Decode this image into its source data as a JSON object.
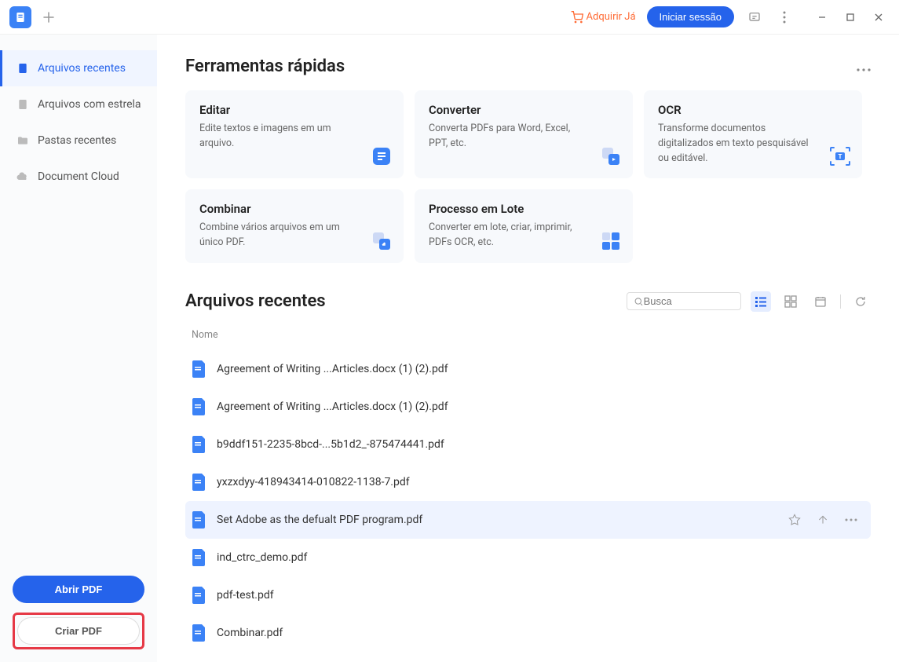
{
  "titlebar": {
    "acquire_label": "Adquirir Já",
    "login_label": "Iniciar sessão"
  },
  "sidebar": {
    "items": [
      {
        "label": "Arquivos recentes"
      },
      {
        "label": "Arquivos com estrela"
      },
      {
        "label": "Pastas recentes"
      },
      {
        "label": "Document Cloud"
      }
    ],
    "open_pdf_label": "Abrir PDF",
    "create_pdf_label": "Criar PDF"
  },
  "quick_tools": {
    "title": "Ferramentas rápidas",
    "cards": [
      {
        "title": "Editar",
        "desc": "Edite textos e imagens em um arquivo."
      },
      {
        "title": "Converter",
        "desc": "Converta PDFs para Word, Excel, PPT, etc."
      },
      {
        "title": "OCR",
        "desc": "Transforme documentos digitalizados em texto pesquisável ou editável."
      },
      {
        "title": "Combinar",
        "desc": "Combine vários arquivos em um único PDF."
      },
      {
        "title": "Processo em Lote",
        "desc": "Converter em lote, criar, imprimir, PDFs OCR, etc."
      }
    ]
  },
  "recent": {
    "title": "Arquivos recentes",
    "search_placeholder": "Busca",
    "name_header": "Nome",
    "files": [
      {
        "name": "Agreement  of  Writing ...Articles.docx (1) (2).pdf"
      },
      {
        "name": "Agreement  of  Writing ...Articles.docx (1) (2).pdf"
      },
      {
        "name": "b9ddf151-2235-8bcd-...5b1d2_-875474441.pdf"
      },
      {
        "name": "yxzxdyy-418943414-010822-1138-7.pdf"
      },
      {
        "name": "Set Adobe as the defualt PDF program.pdf"
      },
      {
        "name": "ind_ctrc_demo.pdf"
      },
      {
        "name": "pdf-test.pdf"
      },
      {
        "name": "Combinar.pdf"
      }
    ]
  }
}
